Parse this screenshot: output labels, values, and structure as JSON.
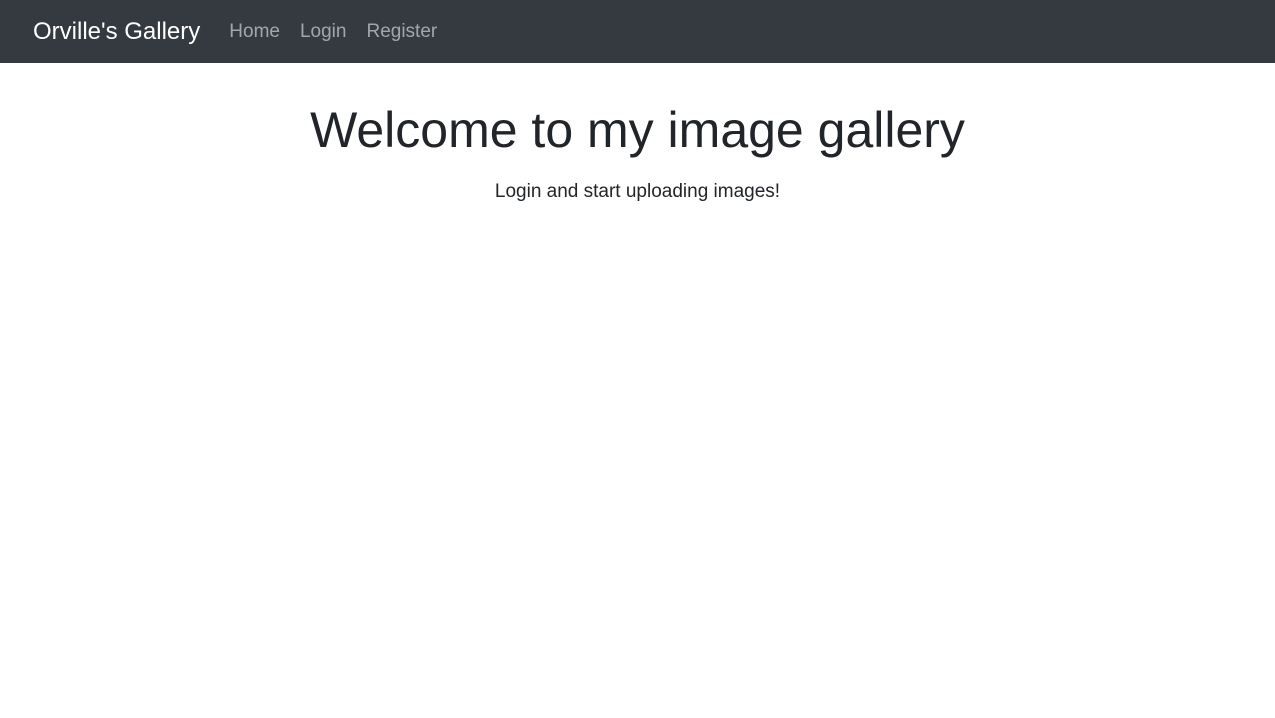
{
  "navbar": {
    "brand": "Orville's Gallery",
    "links": [
      {
        "label": "Home"
      },
      {
        "label": "Login"
      },
      {
        "label": "Register"
      }
    ],
    "background_color": "#343a40",
    "brand_color": "#ffffff",
    "link_color": "#a6a8aa"
  },
  "main": {
    "title": "Welcome to my image gallery",
    "subtitle": "Login and start uploading images!",
    "text_color": "#212529"
  }
}
